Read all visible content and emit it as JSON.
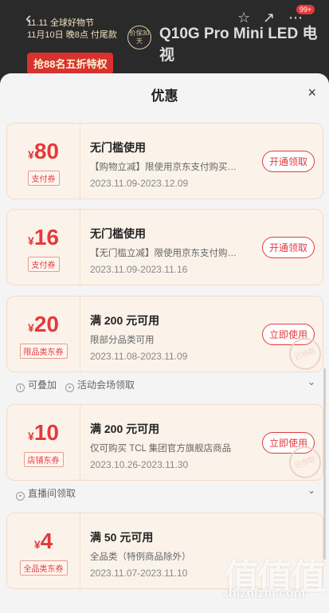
{
  "backdrop": {
    "promo_line1": "11.11 全球好物节",
    "promo_line2": "11月10日 晚8点 付尾款",
    "badge": "价保30天",
    "product_title": "Q10G Pro Mini LED 电视",
    "offer": "抢88名五折特权",
    "cart_count": "99+"
  },
  "sheet": {
    "title": "优惠"
  },
  "coupons": [
    {
      "yen": "¥",
      "amount": "80",
      "tag": "支付券",
      "title": "无门槛使用",
      "desc": "【购物立减】限使用京东支付购买…",
      "date": "2023.11.09-2023.12.09",
      "button": "开通领取"
    },
    {
      "yen": "¥",
      "amount": "16",
      "tag": "支付券",
      "title": "无门槛使用",
      "desc": "【无门槛立减】限使用京东支付购…",
      "date": "2023.11.09-2023.11.16",
      "button": "开通领取"
    },
    {
      "yen": "¥",
      "amount": "20",
      "tag": "限品类东券",
      "title": "满 200 元可用",
      "desc": "限部分品类可用",
      "date": "2023.11.08-2023.11.09",
      "button": "立即使用",
      "stamp": "已领取"
    },
    {
      "yen": "¥",
      "amount": "10",
      "tag": "店铺东券",
      "title": "满 200 元可用",
      "desc": "仅可购买 TCL 集团官方旗舰店商品",
      "date": "2023.10.26-2023.11.30",
      "button": "立即使用",
      "stamp": "已领取"
    },
    {
      "yen": "¥",
      "amount": "4",
      "tag": "全品类东券",
      "title": "满 50 元可用",
      "desc": "全品类（特例商品除外）",
      "date": "2023.11.07-2023.11.10"
    }
  ],
  "info_rows": [
    {
      "items": [
        "可叠加",
        "活动会场领取"
      ]
    },
    {
      "items": [
        "直播间领取"
      ]
    }
  ],
  "watermark": {
    "logo": "值值值",
    "url": "zhizhizhi.com"
  }
}
